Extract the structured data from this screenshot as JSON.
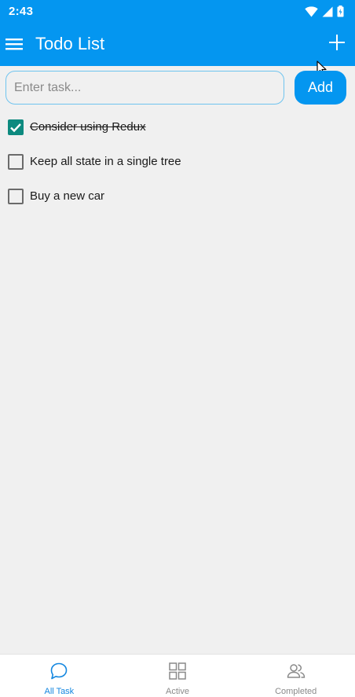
{
  "status_bar": {
    "time": "2:43"
  },
  "app_bar": {
    "title": "Todo List"
  },
  "input": {
    "placeholder": "Enter task...",
    "value": ""
  },
  "add_button": {
    "label": "Add"
  },
  "todos": [
    {
      "text": "Consider using Redux",
      "completed": true
    },
    {
      "text": "Keep all state in a single tree",
      "completed": false
    },
    {
      "text": "Buy a new car",
      "completed": false
    }
  ],
  "bottom_nav": {
    "items": [
      {
        "label": "All Task",
        "icon": "chat-bubble-icon",
        "active": true
      },
      {
        "label": "Active",
        "icon": "grid-icon",
        "active": false
      },
      {
        "label": "Completed",
        "icon": "people-icon",
        "active": false
      }
    ]
  },
  "colors": {
    "primary": "#0496f0",
    "checkbox_checked": "#0d8a7f",
    "nav_active": "#1487e0",
    "background": "#f0f0f0"
  }
}
